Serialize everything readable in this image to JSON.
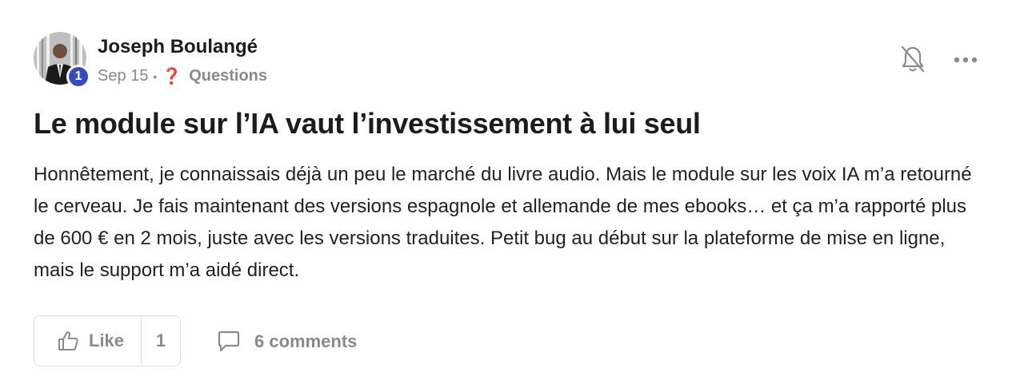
{
  "post": {
    "author": {
      "name": "Joseph Boulangé",
      "level": "1",
      "avatar_icon": "user-avatar-photo"
    },
    "meta": {
      "date": "Sep 15",
      "separator": "•",
      "category_icon": "❓",
      "category": "Questions"
    },
    "title": "Le module sur l’IA vaut l’investissement à lui seul",
    "body": "Honnêtement, je connaissais déjà un peu le marché du livre audio. Mais le module sur les voix IA m’a retourné le cerveau. Je fais maintenant des versions espagnole et allemande de mes ebooks… et ça m’a rapporté plus de 600 € en 2 mois, juste avec les versions traduites. Petit bug au début sur la plateforme de mise en ligne, mais le support m’a aidé direct.",
    "actions": {
      "like_label": "Like",
      "like_count": "1",
      "comments_label": "6 comments"
    },
    "icons": {
      "bell": "bell-off-icon",
      "more": "more-horizontal-icon",
      "like": "thumbs-up-icon",
      "comments": "comment-icon"
    },
    "colors": {
      "badge": "#3b4cb8",
      "question_mark": "#c0392b",
      "muted_text": "#8a8a8a"
    }
  }
}
